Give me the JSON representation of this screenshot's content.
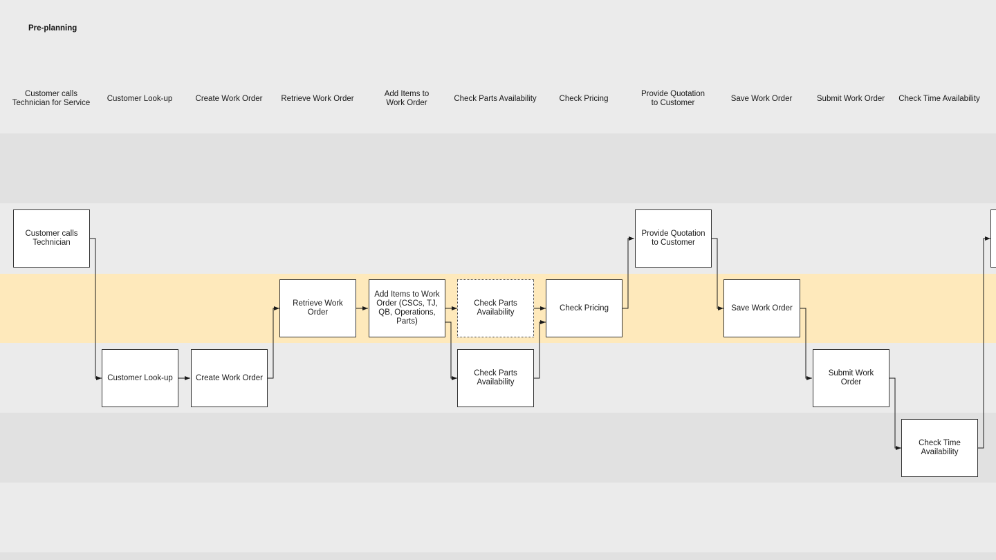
{
  "diagram": {
    "title": "Pre-planning",
    "colors": {
      "background": "#ebebeb",
      "band_alt": "#e1e1e1",
      "band_highlight": "#fee9bb",
      "box_fill": "#ffffff",
      "box_border": "#333333",
      "connector": "#1a1a1a"
    },
    "column_headers": [
      "Customer calls Technician for Service",
      "Customer Look-up",
      "Create Work Order",
      "Retrieve Work Order",
      "Add Items to Work Order",
      "Check Parts Availability",
      "Check Pricing",
      "Provide Quotation to Customer",
      "Save Work Order",
      "Submit Work Order",
      "Check Time Availability"
    ],
    "lanes": [
      {
        "id": "lane-1",
        "highlighted": false
      },
      {
        "id": "lane-2",
        "highlighted": false
      },
      {
        "id": "lane-3",
        "highlighted": true
      },
      {
        "id": "lane-4",
        "highlighted": false
      },
      {
        "id": "lane-5",
        "highlighted": false
      },
      {
        "id": "lane-6",
        "highlighted": false
      }
    ],
    "steps": [
      {
        "id": "s1",
        "label": "Customer calls Technician",
        "lane": 1,
        "column": 0,
        "style": "solid"
      },
      {
        "id": "s2",
        "label": "Customer Look-up",
        "lane": 3,
        "column": 1,
        "style": "solid"
      },
      {
        "id": "s3",
        "label": "Create Work Order",
        "lane": 3,
        "column": 2,
        "style": "solid"
      },
      {
        "id": "s4",
        "label": "Retrieve Work Order",
        "lane": 2,
        "column": 3,
        "style": "solid"
      },
      {
        "id": "s5",
        "label": "Add Items to Work Order (CSCs, TJ, QB, Operations, Parts)",
        "lane": 2,
        "column": 4,
        "style": "solid"
      },
      {
        "id": "s6",
        "label": "Check Parts Availability",
        "lane": 2,
        "column": 5,
        "style": "dotted"
      },
      {
        "id": "s7",
        "label": "Check Parts Availability",
        "lane": 3,
        "column": 5,
        "style": "solid"
      },
      {
        "id": "s8",
        "label": "Check Pricing",
        "lane": 2,
        "column": 6,
        "style": "solid"
      },
      {
        "id": "s9",
        "label": "Provide Quotation to Customer",
        "lane": 1,
        "column": 7,
        "style": "solid"
      },
      {
        "id": "s10",
        "label": "Save Work Order",
        "lane": 2,
        "column": 8,
        "style": "solid"
      },
      {
        "id": "s11",
        "label": "Submit Work Order",
        "lane": 3,
        "column": 9,
        "style": "solid"
      },
      {
        "id": "s12",
        "label": "Check Time Availability",
        "lane": 4,
        "column": 10,
        "style": "solid"
      },
      {
        "id": "s13",
        "label": "",
        "lane": 1,
        "column": 11,
        "style": "solid"
      }
    ],
    "connections": [
      {
        "from": "s1",
        "to": "s2"
      },
      {
        "from": "s2",
        "to": "s3"
      },
      {
        "from": "s3",
        "to": "s4"
      },
      {
        "from": "s4",
        "to": "s5"
      },
      {
        "from": "s5",
        "to": "s6"
      },
      {
        "from": "s5",
        "to": "s7"
      },
      {
        "from": "s6",
        "to": "s8"
      },
      {
        "from": "s7",
        "to": "s8"
      },
      {
        "from": "s8",
        "to": "s9"
      },
      {
        "from": "s9",
        "to": "s10"
      },
      {
        "from": "s10",
        "to": "s11"
      },
      {
        "from": "s11",
        "to": "s12"
      },
      {
        "from": "s12",
        "to": "s13"
      }
    ]
  }
}
